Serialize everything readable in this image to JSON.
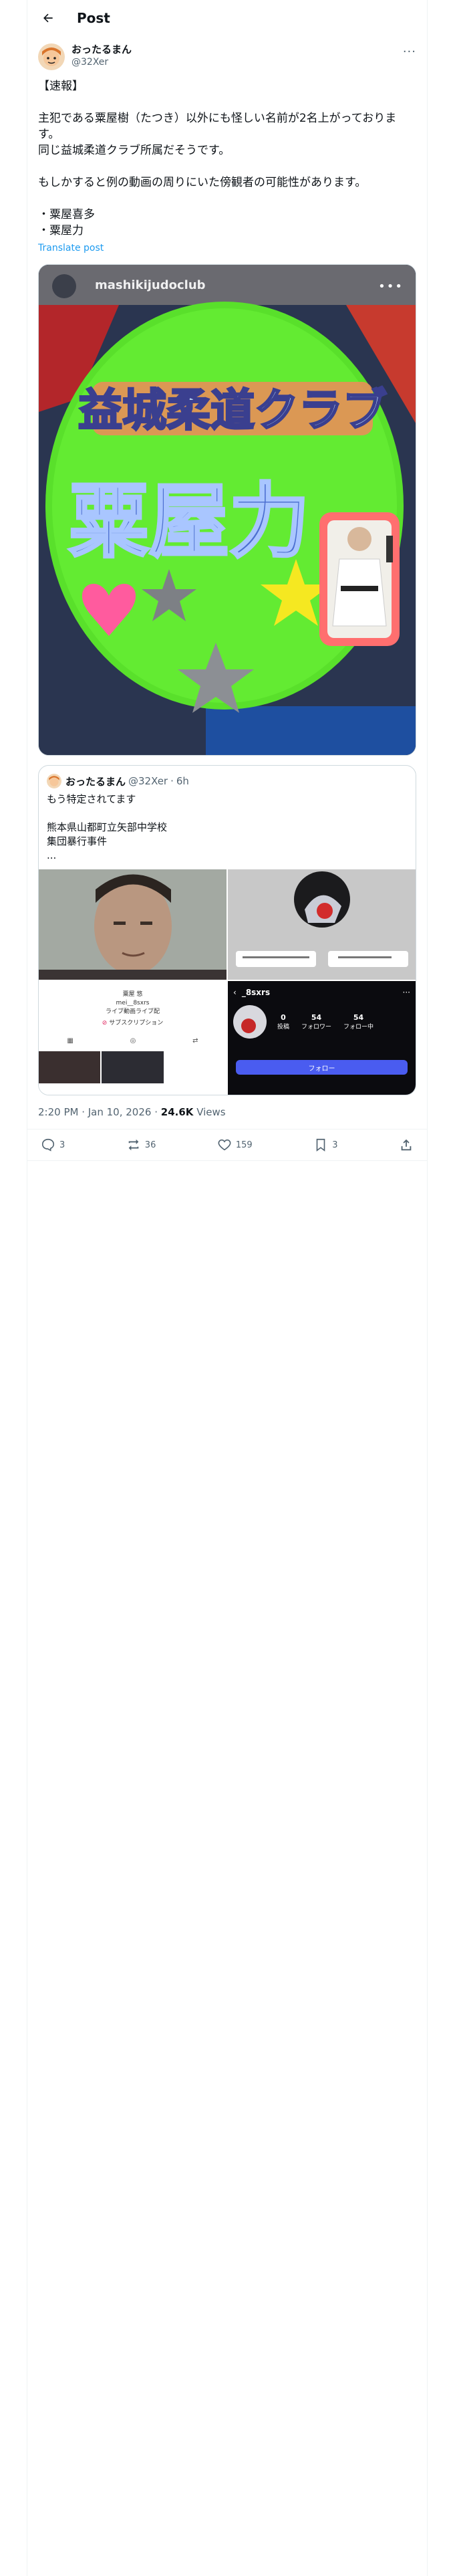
{
  "header": {
    "title": "Post"
  },
  "author": {
    "name": "おったるまん",
    "handle": "@32Xer"
  },
  "tweet": {
    "lines": [
      "【速報】",
      "",
      "主犯である粟屋樹（たつき）以外にも怪しい名前が2名上がっております。",
      "同じ益城柔道クラブ所属だそうです。",
      "",
      "もしかすると例の動画の周りにいた傍観者の可能性があります。",
      "",
      "・粟屋喜多",
      "・粟屋力"
    ],
    "translate_label": "Translate post"
  },
  "media": {
    "account_overlay": "mashikijudoclub",
    "banner_text": "益城柔道クラブ",
    "name_text": "粟屋力"
  },
  "quote": {
    "name": "おったるまん",
    "handle": "@32Xer",
    "time": "6h",
    "lines": [
      "もう特定されてます",
      "",
      "熊本県山都町立矢部中学校",
      "集団暴行事件",
      "..."
    ],
    "profile_card": {
      "display": "粟屋 悠",
      "handle": "mei__8sxrs",
      "live": "ライブ動画ライブ配",
      "subscribe": "サブスクリプション"
    },
    "dark_profile": {
      "username": "_8sxrs",
      "posts_count": "0",
      "posts_label": "投稿",
      "followers_count": "54",
      "followers_label": "フォロワー",
      "following_count": "54",
      "following_label": "フォロー中",
      "follow_label": "フォロー"
    }
  },
  "meta": {
    "time": "2:20 PM · Jan 10, 2026",
    "views_count": "24.6K",
    "views_label": "Views"
  },
  "actions": {
    "replies": "3",
    "reposts": "36",
    "likes": "159",
    "bookmarks": "3"
  },
  "colors": {
    "accent": "#1d9bf0",
    "text": "#0f1419",
    "secondary": "#536471",
    "border": "#cfd9de"
  }
}
